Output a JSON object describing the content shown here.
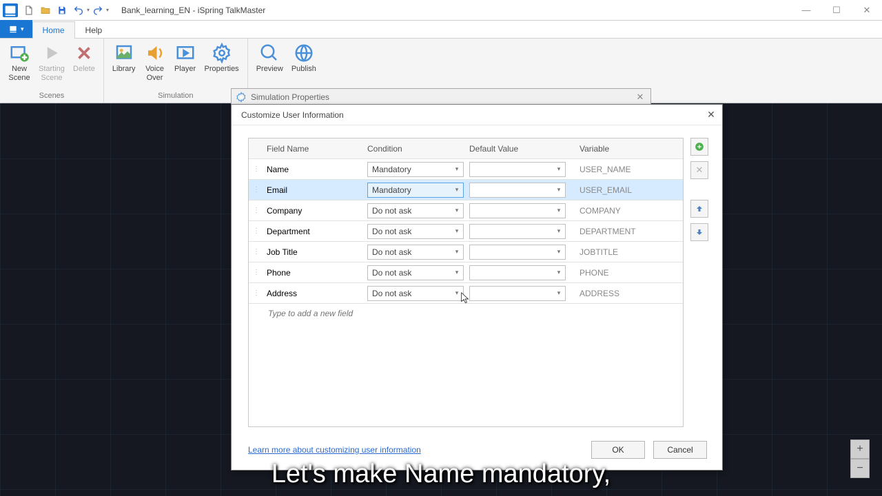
{
  "titlebar": {
    "document": "Bank_learning_EN",
    "app": "iSpring TalkMaster"
  },
  "ribbon_tabs": {
    "home": "Home",
    "help": "Help"
  },
  "ribbon": {
    "new_scene": "New\nScene",
    "starting_scene": "Starting\nScene",
    "delete": "Delete",
    "library": "Library",
    "voice_over": "Voice\nOver",
    "player": "Player",
    "properties": "Properties",
    "preview": "Preview",
    "publish": "Publish",
    "group_scenes": "Scenes",
    "group_simulation": "Simulation"
  },
  "parent_dialog_title": "Simulation Properties",
  "dialog": {
    "title": "Customize User Information",
    "headers": {
      "field": "Field Name",
      "cond": "Condition",
      "def": "Default Value",
      "var": "Variable"
    },
    "rows": [
      {
        "field": "Name",
        "cond": "Mandatory",
        "var": "USER_NAME",
        "selected": false
      },
      {
        "field": "Email",
        "cond": "Mandatory",
        "var": "USER_EMAIL",
        "selected": true
      },
      {
        "field": "Company",
        "cond": "Do not ask",
        "var": "COMPANY",
        "selected": false
      },
      {
        "field": "Department",
        "cond": "Do not ask",
        "var": "DEPARTMENT",
        "selected": false
      },
      {
        "field": "Job Title",
        "cond": "Do not ask",
        "var": "JOBTITLE",
        "selected": false
      },
      {
        "field": "Phone",
        "cond": "Do not ask",
        "var": "PHONE",
        "selected": false
      },
      {
        "field": "Address",
        "cond": "Do not ask",
        "var": "ADDRESS",
        "selected": false
      }
    ],
    "new_field_placeholder": "Type to add a new field",
    "learn_more": "Learn more about customizing user information",
    "ok": "OK",
    "cancel": "Cancel"
  },
  "subtitle": "Let's make Name mandatory,"
}
